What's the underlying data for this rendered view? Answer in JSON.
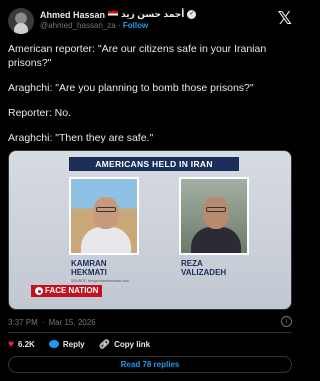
{
  "author": {
    "display_name": "Ahmed Hassan",
    "arabic_name": "أحمد حسن زيد",
    "handle": "@ahmed_hassan_za",
    "separator": "·",
    "follow_label": "Follow"
  },
  "post": {
    "paragraphs": [
      "American reporter: \"Are our citizens safe in your Iranian prisons?\"",
      "Araghchi: \"Are you planning to bomb those prisons?\"",
      "Reporter: No.",
      "Araghchi: \"Then they are safe.\""
    ]
  },
  "media": {
    "banner": "AMERICANS HELD IN IRAN",
    "left_name_line1": "KAMRAN",
    "left_name_line2": "HEKMATI",
    "right_name_line1": "REZA",
    "right_name_line2": "VALIZADEH",
    "source": "SOURCE: bringourfamilieshome.com",
    "logo_text_face": "FACE",
    "logo_text_nation": "NATION"
  },
  "meta": {
    "time": "3:37 PM",
    "separator": "·",
    "date": "Mar 15, 2026"
  },
  "actions": {
    "likes": "6.2K",
    "reply_label": "Reply",
    "copy_label": "Copy link"
  },
  "replies_button": "Read 78 replies",
  "colors": {
    "accent": "#1d9bf0",
    "like": "#f91880",
    "banner": "#1b2f5a",
    "logo": "#c1121f"
  }
}
